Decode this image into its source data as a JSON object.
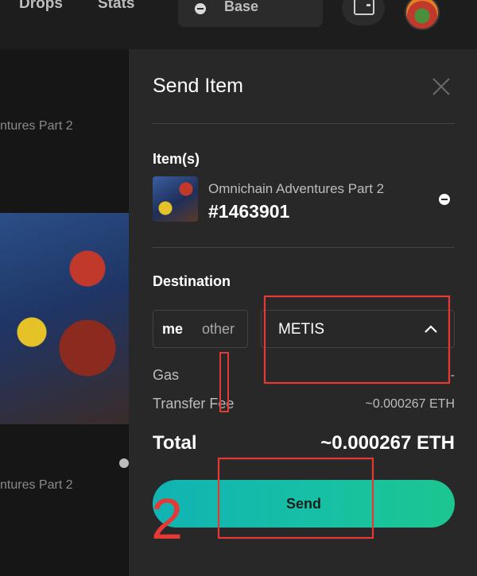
{
  "nav": {
    "items": [
      "Drops",
      "Stats"
    ],
    "chain_label": "Base"
  },
  "background": {
    "card_title_top": "ntures Part 2",
    "card_title_bottom": "ntures Part 2"
  },
  "modal": {
    "title": "Send Item",
    "items_heading": "Item(s)",
    "item": {
      "collection": "Omnichain Adventures Part 2",
      "token_id": "#1463901"
    },
    "destination_heading": "Destination",
    "destination_toggle": {
      "me_label": "me",
      "other_label": "other"
    },
    "chain_dropdown": {
      "selected": "METIS"
    },
    "gas": {
      "label": "Gas",
      "value": "-"
    },
    "transfer_fee": {
      "label": "Transfer Fee",
      "value": "~0.000267 ETH"
    },
    "total": {
      "label": "Total",
      "value": "~0.000267 ETH"
    },
    "send_label": "Send"
  },
  "annotations": {
    "step_number": "2",
    "color": "#e53935"
  },
  "colors": {
    "modal_bg": "#282828",
    "send_gradient_start": "#11b3b3",
    "send_gradient_end": "#1cc690"
  }
}
